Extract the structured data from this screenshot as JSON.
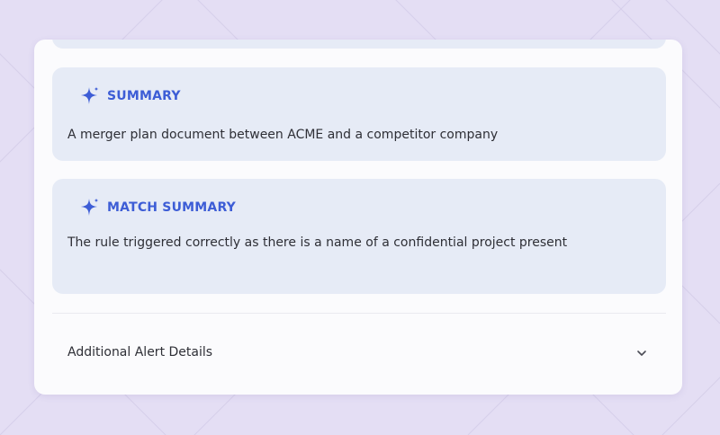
{
  "colors": {
    "background": "#e4def4",
    "panel": "#fbfbfd",
    "card": "#e6ebf6",
    "accent": "#3d5dd6",
    "text": "#2e2f36"
  },
  "summary_card": {
    "icon": "sparkle-icon",
    "title": "SUMMARY",
    "body": "A merger plan document between ACME and a competitor company"
  },
  "match_summary_card": {
    "icon": "sparkle-icon",
    "title": "MATCH SUMMARY",
    "body": "The rule triggered correctly as there is a name of a confidential project present"
  },
  "additional_details": {
    "label": "Additional Alert Details",
    "icon": "chevron-down-icon"
  }
}
